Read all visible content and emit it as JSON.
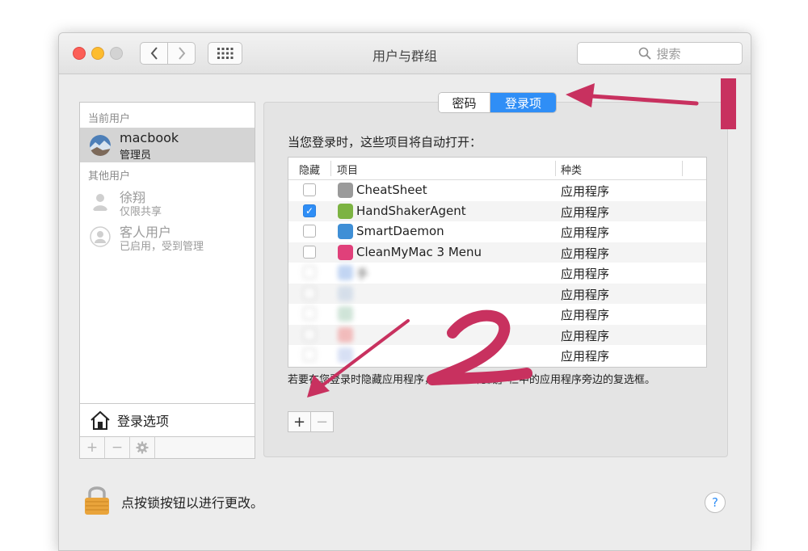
{
  "window": {
    "title": "用户与群组",
    "search_placeholder": "搜索"
  },
  "sidebar": {
    "current_users_label": "当前用户",
    "other_users_label": "其他用户",
    "current_user": {
      "name": "macbook",
      "role": "管理员"
    },
    "other_users": [
      {
        "name": "徐翔",
        "role": "仅限共享"
      },
      {
        "name": "客人用户",
        "role": "已启用，受到管理"
      }
    ],
    "login_options_label": "登录选项",
    "toolbar": {
      "add": "+",
      "remove": "−"
    }
  },
  "tabs": {
    "password": "密码",
    "login_items": "登录项",
    "active": "login_items"
  },
  "main": {
    "heading": "当您登录时，这些项目将自动打开：",
    "columns": {
      "hide": "隐藏",
      "item": "项目",
      "kind": "种类"
    },
    "items": [
      {
        "name": "CheatSheet",
        "kind": "应用程序",
        "hidden": false,
        "icon": "cheatsheet-icon"
      },
      {
        "name": "HandShakerAgent",
        "kind": "应用程序",
        "hidden": true,
        "icon": "android-icon"
      },
      {
        "name": "SmartDaemon",
        "kind": "应用程序",
        "hidden": false,
        "icon": "smartdaemon-icon"
      },
      {
        "name": "CleanMyMac 3 Menu",
        "kind": "应用程序",
        "hidden": false,
        "icon": "cleanmymac-icon"
      },
      {
        "name": "手",
        "kind": "应用程序",
        "hidden": false,
        "blurred": true
      },
      {
        "name": "",
        "kind": "应用程序",
        "hidden": false,
        "blurred": true
      },
      {
        "name": "",
        "kind": "应用程序",
        "hidden": false,
        "blurred": true
      },
      {
        "name": "",
        "kind": "应用程序",
        "hidden": false,
        "blurred": true
      },
      {
        "name": "",
        "kind": "应用程序",
        "hidden": false,
        "blurred": true
      }
    ],
    "hint": "若要在您登录时隐藏应用程序，请选中「隐藏」栏中的应用程序旁边的复选框。",
    "add_button": "+",
    "remove_button": "−"
  },
  "footer": {
    "lock_text": "点按锁按钮以进行更改。",
    "help": "?"
  },
  "colors": {
    "accent": "#2f8ef6",
    "annotation": "#c8315f"
  }
}
